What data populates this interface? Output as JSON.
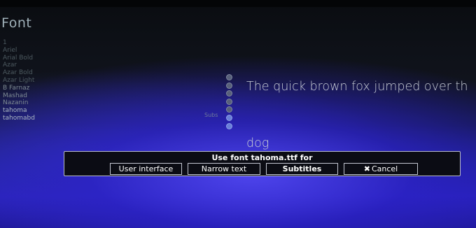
{
  "header": {
    "title": "Font"
  },
  "font_list": {
    "items": [
      {
        "label": "1",
        "tone": "dim"
      },
      {
        "label": "Ariel",
        "tone": "dim"
      },
      {
        "label": "Arial Bold",
        "tone": "dim"
      },
      {
        "label": "Azar",
        "tone": "dim"
      },
      {
        "label": "Azar Bold",
        "tone": "dim"
      },
      {
        "label": "Azar Light",
        "tone": "dim"
      },
      {
        "label": "B Farnaz",
        "tone": "normal"
      },
      {
        "label": "Mashad",
        "tone": "normal"
      },
      {
        "label": "Nazanin",
        "tone": "normal"
      },
      {
        "label": "tahoma",
        "tone": "bright"
      },
      {
        "label": "tahomabd",
        "tone": "bright"
      }
    ],
    "subs_label": "Subs"
  },
  "preview": {
    "line1": "The quick brown fox jumped over th",
    "line2": "dog"
  },
  "dialog": {
    "title": "Use font tahoma.ttf for",
    "buttons": {
      "user_interface": "User interface",
      "narrow_text": "Narrow text",
      "subtitles": "Subtitles",
      "cancel": "Cancel",
      "cancel_icon": "✖"
    }
  },
  "colors": {
    "dialog_bg": "#0b0c14",
    "dialog_border": "#b9bcc8",
    "preview_text": "#c8cdd6"
  }
}
